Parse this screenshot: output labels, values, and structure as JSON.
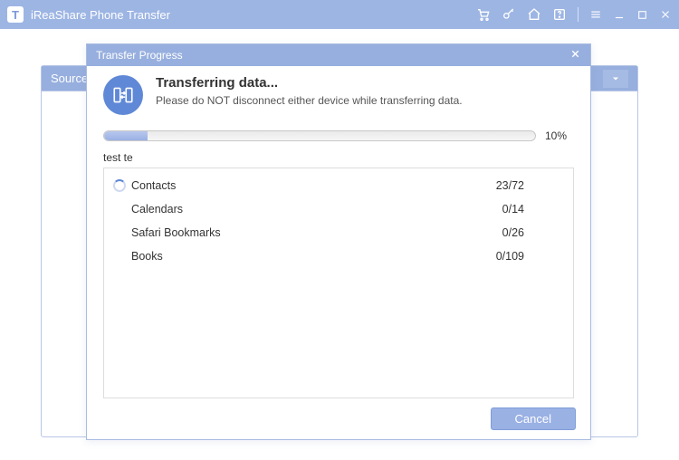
{
  "app": {
    "logo_letter": "T",
    "title": "iReaShare Phone Transfer"
  },
  "background": {
    "source_label": "Source:"
  },
  "modal": {
    "header": "Transfer Progress",
    "title": "Transferring data...",
    "subtitle": "Please do NOT disconnect either device while transferring data.",
    "progress_pct": "10%",
    "progress_fill_width": "10%",
    "subcaption": "test te",
    "items": [
      {
        "label": "Contacts",
        "count": "23/72",
        "spinning": true
      },
      {
        "label": "Calendars",
        "count": "0/14",
        "spinning": false
      },
      {
        "label": "Safari Bookmarks",
        "count": "0/26",
        "spinning": false
      },
      {
        "label": "Books",
        "count": "0/109",
        "spinning": false
      }
    ],
    "cancel_label": "Cancel"
  }
}
